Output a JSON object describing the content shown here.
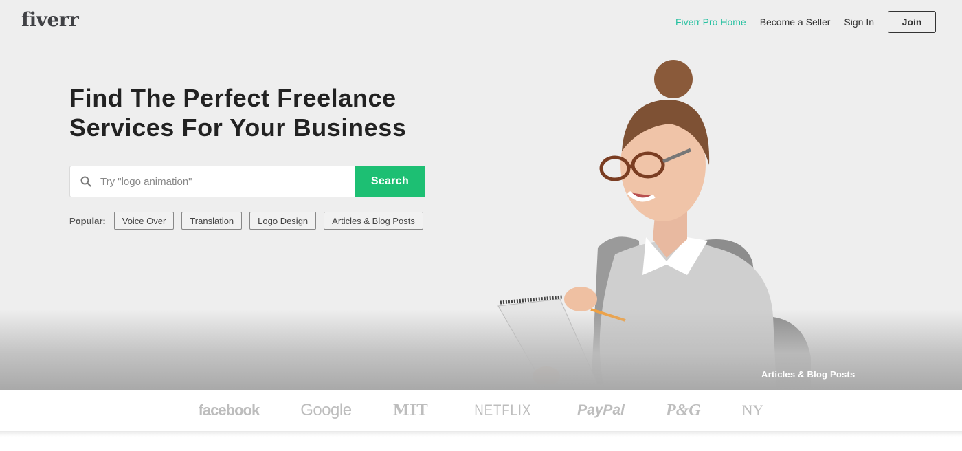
{
  "header": {
    "logo": "fiverr",
    "nav": {
      "pro_home": "Fiverr Pro Home",
      "become_seller": "Become a Seller",
      "sign_in": "Sign In",
      "join": "Join"
    }
  },
  "hero": {
    "headline_line1": "Find The Perfect Freelance",
    "headline_line2": "Services For Your Business",
    "search": {
      "placeholder": "Try \"logo animation\"",
      "value": "",
      "button": "Search",
      "icon": "search-icon"
    },
    "popular": {
      "label": "Popular:",
      "items": [
        "Voice Over",
        "Translation",
        "Logo Design",
        "Articles & Blog Posts"
      ]
    },
    "image_caption": "Articles & Blog Posts"
  },
  "trusted_by": {
    "brands": [
      "facebook",
      "Google",
      "MIT",
      "NETFLIX",
      "PayPal",
      "P&G",
      "NY"
    ]
  },
  "colors": {
    "accent_green": "#1dbf73",
    "pro_link": "#25c0a0",
    "hero_bg": "#eeeeee"
  }
}
